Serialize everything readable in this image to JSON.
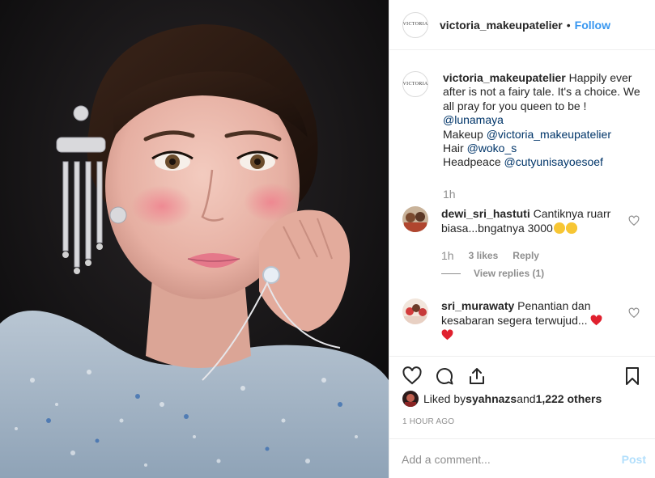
{
  "post": {
    "username": "victoria_makeupatelier",
    "separator": "•",
    "follow_label": "Follow",
    "logo_text": "VICTORIA"
  },
  "caption": {
    "username": "victoria_makeupatelier",
    "line1": " Happily ever after is not a fairy tale. It's a choice. We all pray for you queen to be !",
    "mention1": "@lunamaya",
    "makeup_label": "Makeup ",
    "makeup_mention": "@victoria_makeupatelier",
    "hair_label": "Hair ",
    "hair_mention": "@woko_s",
    "headpiece_label": "Headpeace ",
    "headpiece_mention": "@cutyunisayoesoef",
    "time": "1h"
  },
  "comments": [
    {
      "username": "dewi_sri_hastuti",
      "text": " Cantiknya ruarr biasa...bngatnya 3000",
      "time": "1h",
      "likes": "3 likes",
      "reply_label": "Reply",
      "view_replies": "View replies (1)"
    },
    {
      "username": "sri_murawaty",
      "text": " Penantian dan kesabaran segera terwujud..."
    }
  ],
  "likes": {
    "prefix": "Liked by ",
    "user": "syahnazs",
    "middle": " and ",
    "count": "1,222 others"
  },
  "time_ago": "1 HOUR AGO",
  "add_comment": {
    "placeholder": "Add a comment...",
    "post_label": "Post"
  },
  "icons": {
    "like": "heart-icon",
    "comment": "comment-icon",
    "share": "share-icon",
    "save": "bookmark-icon"
  },
  "colors": {
    "link": "#3897f0",
    "mention": "#003569",
    "muted": "#8e8e8e",
    "heart": "#ed4956"
  }
}
